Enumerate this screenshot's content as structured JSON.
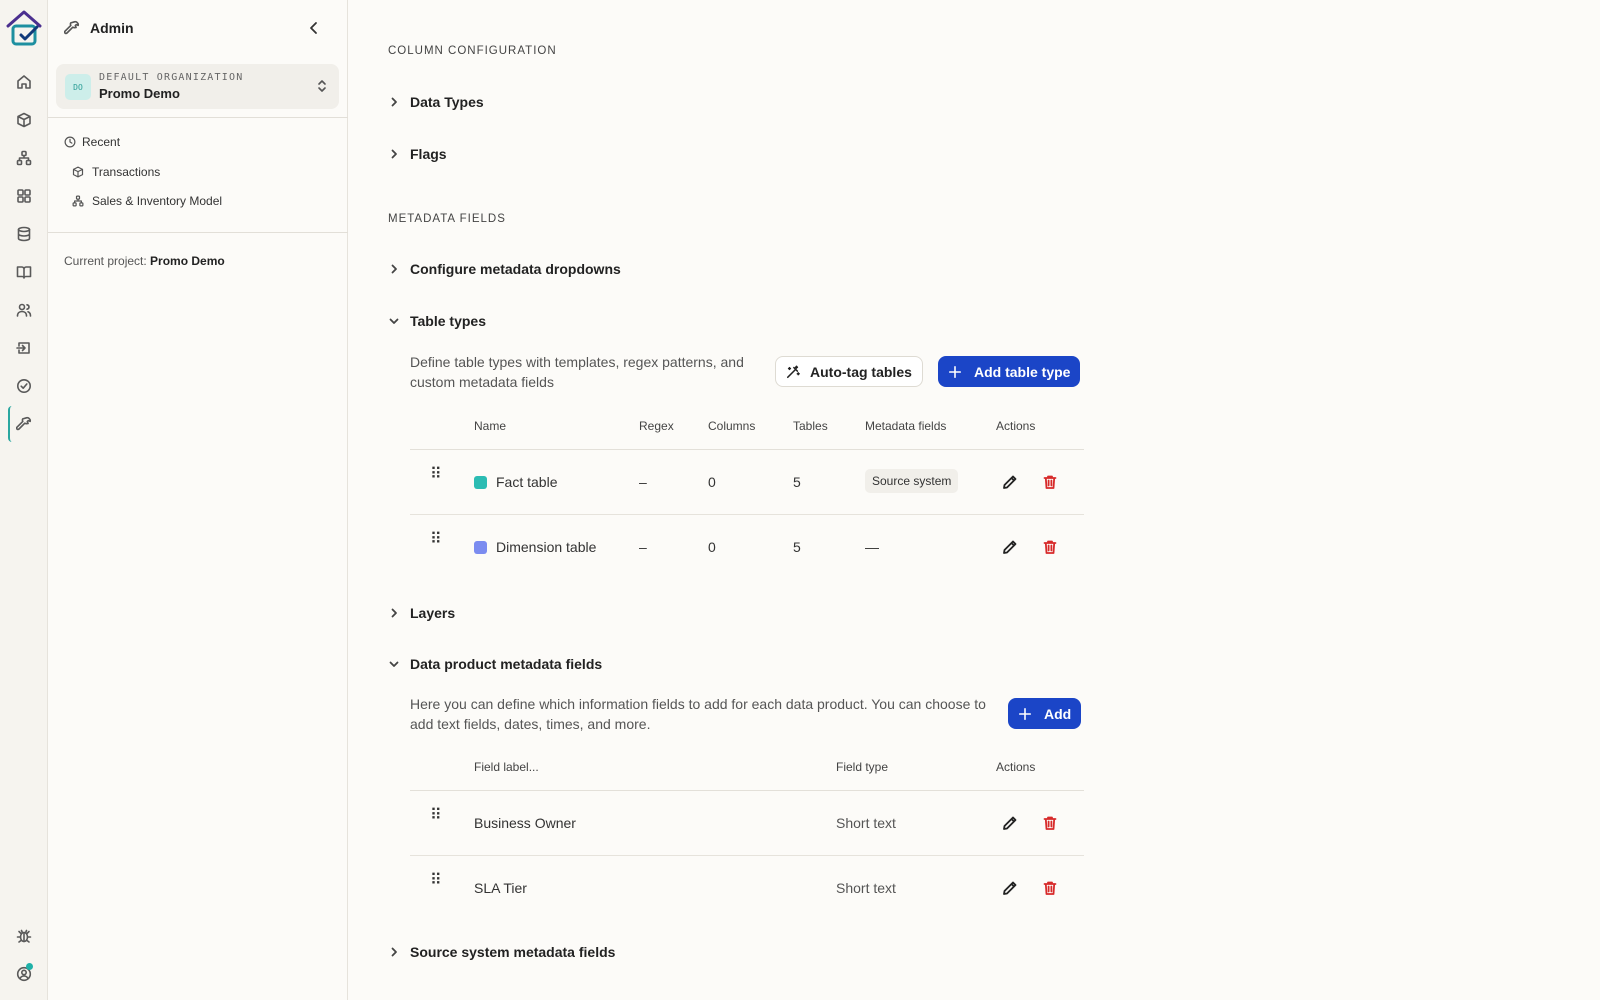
{
  "sidebar": {
    "title": "Admin",
    "org": {
      "badge": "DO",
      "label": "DEFAULT ORGANIZATION",
      "name": "Promo Demo"
    },
    "recent_label": "Recent",
    "recent": [
      {
        "label": "Transactions",
        "icon": "cube-icon"
      },
      {
        "label": "Sales & Inventory Model",
        "icon": "hierarchy-icon"
      }
    ],
    "current_project_label": "Current project:",
    "current_project": "Promo Demo"
  },
  "sections": {
    "column_config": "COLUMN CONFIGURATION",
    "metadata_fields": "METADATA FIELDS"
  },
  "accordions": {
    "data_types": "Data Types",
    "flags": "Flags",
    "configure_dropdowns": "Configure metadata dropdowns",
    "table_types": "Table types",
    "layers": "Layers",
    "data_product_fields": "Data product metadata fields",
    "source_system_fields": "Source system metadata fields"
  },
  "table_types": {
    "description": "Define table types with templates, regex patterns, and custom metadata fields",
    "auto_tag_label": "Auto-tag tables",
    "add_label": "Add table type",
    "columns": [
      "Name",
      "Regex",
      "Columns",
      "Tables",
      "Metadata fields",
      "Actions"
    ],
    "rows": [
      {
        "name": "Fact table",
        "color": "#2bbcb3",
        "regex": "–",
        "columns": "0",
        "tables": "5",
        "metadata": "Source system"
      },
      {
        "name": "Dimension table",
        "color": "#7b8cf0",
        "regex": "–",
        "columns": "0",
        "tables": "5",
        "metadata": "—"
      }
    ]
  },
  "data_product_fields": {
    "description": "Here you can define which information fields to add for each data product. You can choose to add text fields, dates, times, and more.",
    "add_label": "Add",
    "columns": [
      "Field label...",
      "Field type",
      "Actions"
    ],
    "rows": [
      {
        "label": "Business Owner",
        "type": "Short text"
      },
      {
        "label": "SLA Tier",
        "type": "Short text"
      }
    ]
  },
  "colors": {
    "accent": "#1b45c7",
    "teal": "#2aa7a0",
    "danger": "#d72a2a",
    "background": "#fcfbf8"
  }
}
